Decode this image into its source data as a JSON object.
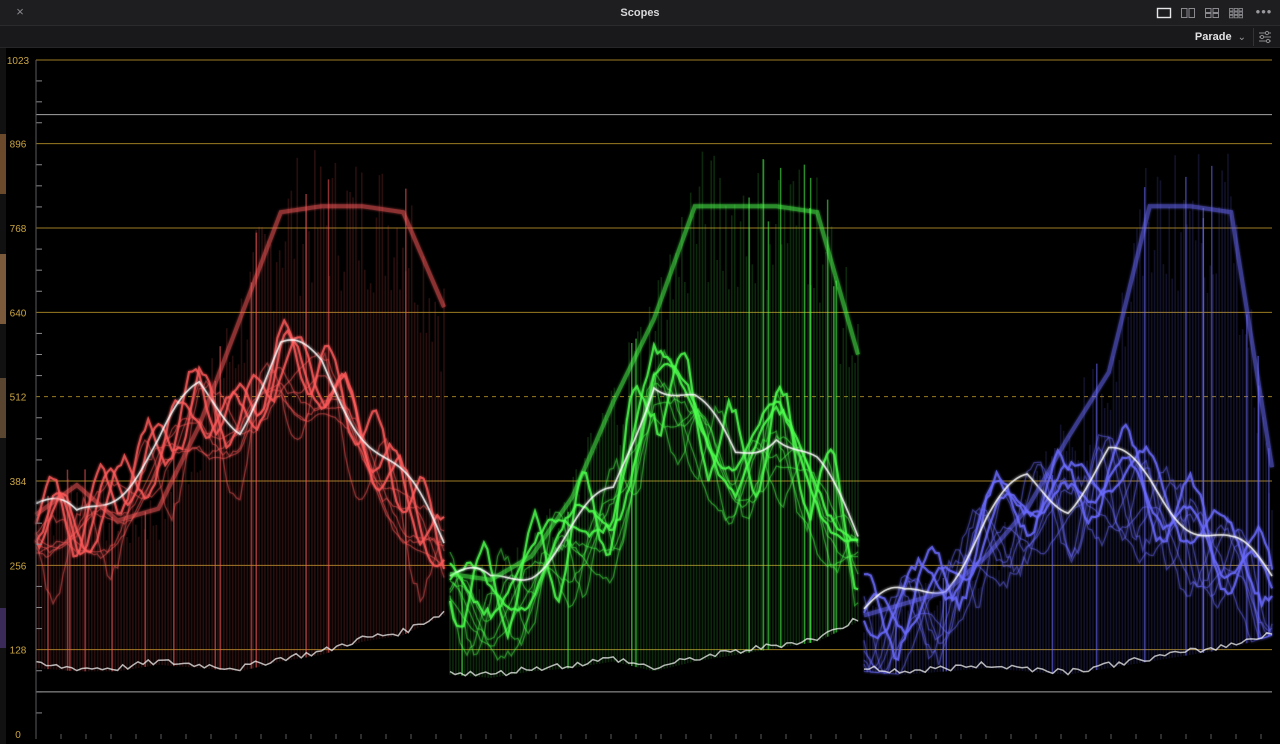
{
  "window": {
    "title": "Scopes",
    "close_icon": "×",
    "more_icon": "•••",
    "layout_buttons": [
      "single-view-icon",
      "dual-view-icon",
      "quad-view-icon",
      "grid-view-icon"
    ]
  },
  "toolbar": {
    "scope_type": "Parade",
    "dropdown_icon": "chevron-down-icon",
    "settings_icon": "sliders-icon"
  },
  "scale": {
    "ticks": [
      "0",
      "128",
      "256",
      "384",
      "512",
      "640",
      "768",
      "896",
      "1023"
    ],
    "gridline_color": "#b8922a",
    "midline_value": 512
  },
  "colors": {
    "red_channel": "#ff5a5a",
    "green_channel": "#4dff4d",
    "blue_channel": "#6b6bff",
    "label_color": "#c9a441",
    "panel_bg": "#1e1e21"
  },
  "chart_data": {
    "type": "line",
    "title": "",
    "ylim": [
      0,
      1023
    ],
    "yticks": [
      0,
      128,
      256,
      384,
      512,
      640,
      768,
      896,
      1023
    ],
    "series": [
      {
        "name": "",
        "channel": "red",
        "envelope_top": [
          370,
          420,
          360,
          380,
          520,
          700,
          880,
          890,
          890,
          880,
          720
        ],
        "bright_trace": [
          350,
          320,
          380,
          440,
          520,
          480,
          580,
          560,
          470,
          380,
          290
        ],
        "floor": [
          100,
          95,
          95,
          105,
          100,
          95,
          110,
          120,
          140,
          150,
          180
        ]
      },
      {
        "name": "",
        "channel": "green",
        "envelope_top": [
          270,
          260,
          300,
          400,
          560,
          700,
          890,
          890,
          890,
          880,
          640
        ],
        "bright_trace": [
          240,
          220,
          260,
          310,
          360,
          550,
          500,
          420,
          470,
          400,
          300
        ],
        "floor": [
          90,
          85,
          95,
          100,
          110,
          95,
          110,
          120,
          130,
          140,
          170
        ]
      },
      {
        "name": "",
        "channel": "blue",
        "envelope_top": [
          200,
          220,
          240,
          300,
          380,
          500,
          610,
          890,
          890,
          880,
          450
        ],
        "bright_trace": [
          190,
          200,
          240,
          320,
          380,
          360,
          420,
          380,
          330,
          280,
          240
        ],
        "floor": [
          95,
          90,
          95,
          100,
          95,
          90,
          100,
          110,
          120,
          130,
          150
        ]
      }
    ]
  }
}
